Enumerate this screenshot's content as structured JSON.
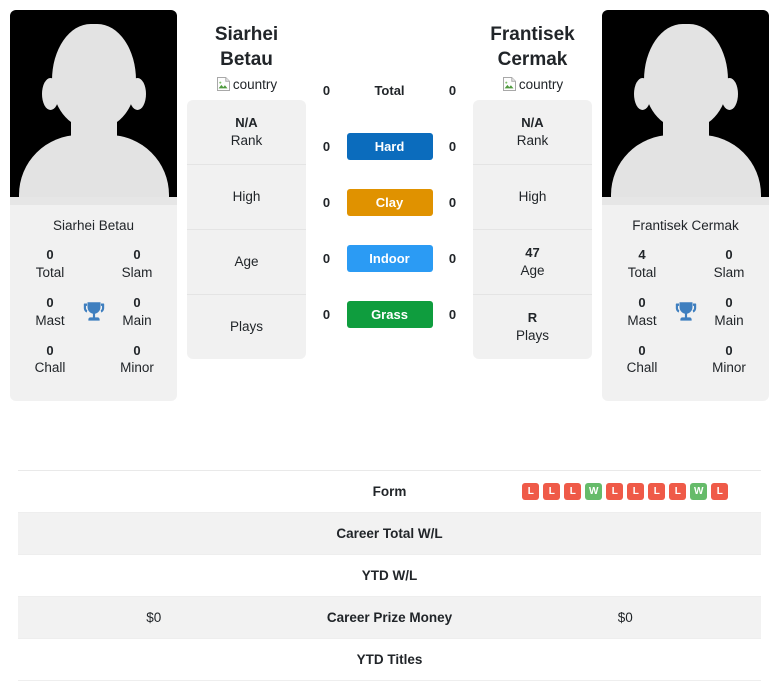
{
  "players": {
    "left": {
      "name": "Siarhei Betau",
      "card_name": "Siarhei Betau",
      "country_label": "country",
      "titles": [
        {
          "num": "0",
          "label": "Total"
        },
        {
          "num": "0",
          "label": "Slam"
        },
        {
          "num": "0",
          "label": "Mast"
        },
        {
          "num": "0",
          "label": "Main"
        },
        {
          "num": "0",
          "label": "Chall"
        },
        {
          "num": "0",
          "label": "Minor"
        }
      ],
      "info": [
        {
          "value": "N/A",
          "label": "Rank"
        },
        {
          "value": "",
          "label": "High"
        },
        {
          "value": "",
          "label": "Age"
        },
        {
          "value": "",
          "label": "Plays"
        }
      ]
    },
    "right": {
      "name": "Frantisek Cermak",
      "card_name": "Frantisek Cermak",
      "country_label": "country",
      "titles": [
        {
          "num": "4",
          "label": "Total"
        },
        {
          "num": "0",
          "label": "Slam"
        },
        {
          "num": "0",
          "label": "Mast"
        },
        {
          "num": "0",
          "label": "Main"
        },
        {
          "num": "0",
          "label": "Chall"
        },
        {
          "num": "0",
          "label": "Minor"
        }
      ],
      "info": [
        {
          "value": "N/A",
          "label": "Rank"
        },
        {
          "value": "",
          "label": "High"
        },
        {
          "value": "47",
          "label": "Age"
        },
        {
          "value": "R",
          "label": "Plays"
        }
      ]
    }
  },
  "surfaces": [
    {
      "label": "Total",
      "left": "0",
      "right": "0",
      "color": "",
      "plain": true
    },
    {
      "label": "Hard",
      "left": "0",
      "right": "0",
      "color": "#0b6cbd",
      "plain": false
    },
    {
      "label": "Clay",
      "left": "0",
      "right": "0",
      "color": "#e09200",
      "plain": false
    },
    {
      "label": "Indoor",
      "left": "0",
      "right": "0",
      "color": "#2b9bf4",
      "plain": false
    },
    {
      "label": "Grass",
      "left": "0",
      "right": "0",
      "color": "#0f9d3e",
      "plain": false
    }
  ],
  "stats_rows": [
    {
      "label": "Form",
      "left": "",
      "right": "",
      "type": "form"
    },
    {
      "label": "Career Total W/L",
      "left": "",
      "right": "",
      "type": "text"
    },
    {
      "label": "YTD W/L",
      "left": "",
      "right": "",
      "type": "text"
    },
    {
      "label": "Career Prize Money",
      "left": "$0",
      "right": "$0",
      "type": "text"
    },
    {
      "label": "YTD Titles",
      "left": "",
      "right": "",
      "type": "text"
    }
  ],
  "form": {
    "results": [
      "L",
      "L",
      "L",
      "W",
      "L",
      "L",
      "L",
      "L",
      "W",
      "L"
    ],
    "win_color": "#66bb6a",
    "loss_color": "#ef5a48"
  },
  "colors": {
    "trophy": "#3f7fbf",
    "card_bg": "#f1f1f1",
    "row_stripe": "#f2f2f2"
  }
}
